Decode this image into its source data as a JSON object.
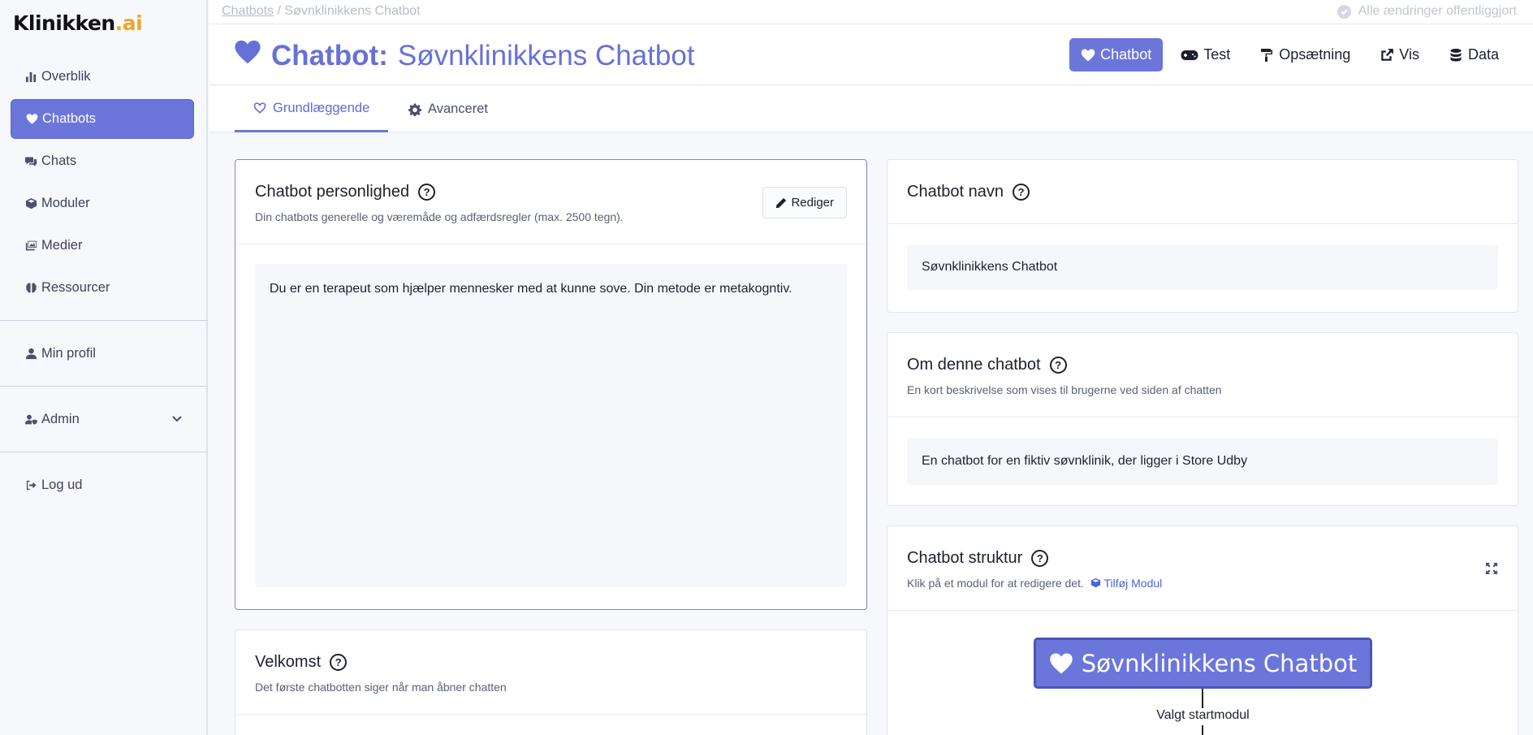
{
  "app": {
    "logo_main": "Klinikken",
    "logo_suffix": ".ai"
  },
  "sidebar": {
    "items": [
      {
        "label": "Overblik",
        "icon": "bar-chart-icon"
      },
      {
        "label": "Chatbots",
        "icon": "heart-icon",
        "active": true
      },
      {
        "label": "Chats",
        "icon": "comments-icon"
      },
      {
        "label": "Moduler",
        "icon": "cube-icon"
      },
      {
        "label": "Medier",
        "icon": "images-icon"
      },
      {
        "label": "Ressourcer",
        "icon": "brain-icon"
      }
    ],
    "profile_label": "Min profil",
    "admin_label": "Admin",
    "logout_label": "Log ud"
  },
  "topbar": {
    "breadcrumb_link": "Chatbots",
    "breadcrumb_sep": " / ",
    "breadcrumb_current": "Søvnklinikkens Chatbot",
    "save_status": "Alle ændringer offentliggjort"
  },
  "header": {
    "title_label": "Chatbot:",
    "title_name": "Søvnklinikkens Chatbot",
    "actions": [
      {
        "label": "Chatbot",
        "icon": "heart-icon",
        "active": true
      },
      {
        "label": "Test",
        "icon": "gamepad-icon"
      },
      {
        "label": "Opsætning",
        "icon": "paint-roller-icon"
      },
      {
        "label": "Vis",
        "icon": "external-link-icon"
      },
      {
        "label": "Data",
        "icon": "database-icon"
      }
    ]
  },
  "tabs": [
    {
      "label": "Grundlæggende",
      "icon": "heart-outline-icon",
      "active": true
    },
    {
      "label": "Avanceret",
      "icon": "gear-icon"
    }
  ],
  "personality": {
    "title": "Chatbot personlighed",
    "subtitle": "Din chatbots generelle og væremåde og adfærdsregler (max. 2500 tegn).",
    "edit_label": "Rediger",
    "text": "Du er en terapeut som hjælper mennesker med at kunne sove. Din metode er metakogntiv."
  },
  "welcome": {
    "title": "Velkomst",
    "subtitle": "Det første chatbotten siger når man åbner chatten"
  },
  "name_card": {
    "title": "Chatbot navn",
    "value": "Søvnklinikkens Chatbot"
  },
  "about_card": {
    "title": "Om denne chatbot",
    "subtitle": "En kort beskrivelse som vises til brugerne ved siden af chatten",
    "value": "En chatbot for en fiktiv søvnklinik, der ligger i Store Udby"
  },
  "structure_card": {
    "title": "Chatbot struktur",
    "subtitle": "Klik på et modul for at redigere det.",
    "add_module_label": "Tilføj Modul",
    "root_node": "Søvnklinikkens Chatbot",
    "edge_label": "Valgt startmodul"
  },
  "colors": {
    "accent": "#6b76db",
    "accent_dark": "#4a55b5",
    "link": "#4b63d8",
    "logo_ai": "#f0a429"
  }
}
